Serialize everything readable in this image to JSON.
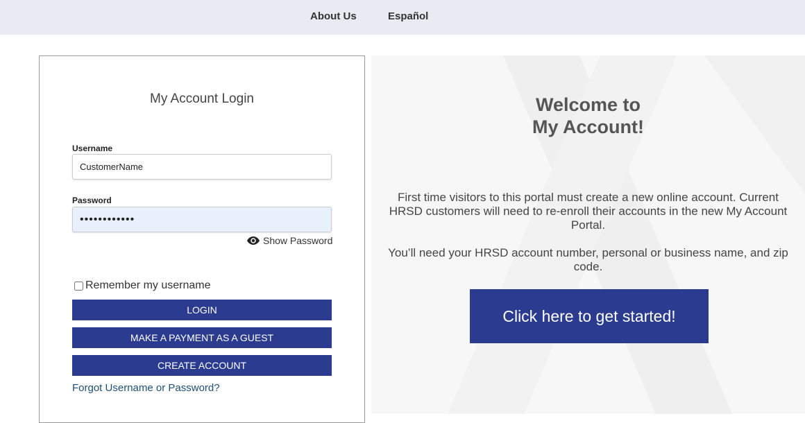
{
  "nav": {
    "about": "About Us",
    "espanol": "Español"
  },
  "login": {
    "title": "My Account Login",
    "username_label": "Username",
    "username_value": "CustomerName",
    "password_label": "Password",
    "password_value": "••••••••••••",
    "show_password": "Show Password",
    "remember_label": "Remember my username",
    "login_button": "LOGIN",
    "guest_button": "MAKE A PAYMENT AS A GUEST",
    "create_button": "CREATE ACCOUNT",
    "forgot_link": "Forgot Username or Password?"
  },
  "welcome": {
    "title_line1": "Welcome to",
    "title_line2": "My Account!",
    "para1": "First time visitors to this portal must create a new online account. Current HRSD customers will need to re-enroll their accounts in the new My Account Portal.",
    "para2": "You’ll need your HRSD account number, personal or business name, and zip code.",
    "cta_button": "Click here to get started!"
  },
  "colors": {
    "accent": "#2b3b8f",
    "topbar": "#e8ebf2",
    "link": "#1f4e79"
  }
}
